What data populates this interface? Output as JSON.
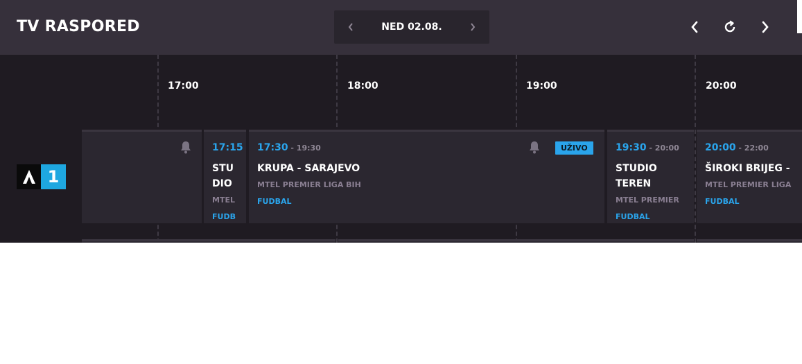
{
  "header": {
    "title": "TV RASPORED",
    "date": "NED 02.08."
  },
  "timeline": {
    "labels": [
      "17:00",
      "18:00",
      "19:00",
      "20:00"
    ]
  },
  "channel": {
    "logo_text": "1"
  },
  "programs": [
    {
      "start": "17:15",
      "end": "",
      "title": "STU DIO",
      "league": "MTEL",
      "genre": "FUDB"
    },
    {
      "start": "17:30",
      "end": " - 19:30",
      "title": "KRUPA - SARAJEVO",
      "league": "MTEL PREMIER LIGA BIH",
      "genre": "FUDBAL",
      "badge": "UŽIVO"
    },
    {
      "start": "19:30",
      "end": " - 20:00",
      "title": "STUDIO TEREN",
      "league": "MTEL PREMIER",
      "genre": "FUDBAL"
    },
    {
      "start": "20:00",
      "end": " - 22:00",
      "title": "ŠIROKI BRIJEG - ",
      "league": "MTEL PREMIER LIGA",
      "genre": "FUDBAL"
    }
  ],
  "colors": {
    "header_bg": "#36303b",
    "grid_bg": "#1f1b22",
    "cell_bg": "#2b2730",
    "accent": "#2aa4eb"
  }
}
